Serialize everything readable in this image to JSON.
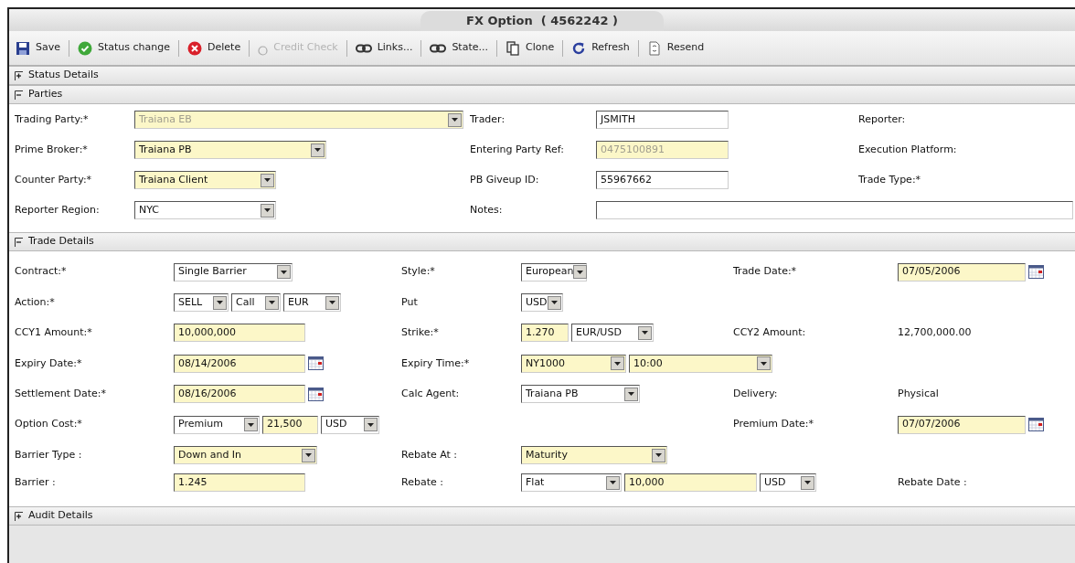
{
  "window": {
    "title": "FX Option  ( 4562242 )"
  },
  "toolbar": [
    {
      "kind": "save",
      "label": "Save",
      "disabled": false
    },
    {
      "kind": "status",
      "label": "Status change",
      "disabled": false
    },
    {
      "kind": "delete",
      "label": "Delete",
      "disabled": false
    },
    {
      "kind": "credit",
      "label": "Credit Check",
      "disabled": true
    },
    {
      "kind": "link",
      "label": "Links...",
      "disabled": false
    },
    {
      "kind": "link",
      "label": "State...",
      "disabled": false
    },
    {
      "kind": "clone",
      "label": "Clone",
      "disabled": false
    },
    {
      "kind": "refresh",
      "label": "Refresh",
      "disabled": false
    },
    {
      "kind": "resend",
      "label": "Resend",
      "disabled": false
    }
  ],
  "sections": [
    {
      "title": "Status Details",
      "expanded": false
    },
    {
      "title": "Parties",
      "expanded": true,
      "rows": [
        {
          "col_1": {
            "label": "Trading Party:*",
            "controls": [
              {
                "kind": "select",
                "value": "Traiana EB",
                "highlighted": true,
                "disabled": true
              }
            ]
          },
          "col_2": {
            "label": "Trader:",
            "controls": [
              {
                "kind": "input",
                "value": "JSMITH",
                "highlighted": false,
                "disabled": false
              }
            ]
          },
          "col_3": {
            "label": "Reporter:"
          }
        },
        {
          "col_1": {
            "label": "Prime Broker:*",
            "controls": [
              {
                "kind": "select",
                "value": "Traiana PB",
                "highlighted": true,
                "disabled": false
              }
            ]
          },
          "col_2": {
            "label": "Entering Party Ref:",
            "controls": [
              {
                "kind": "input",
                "value": "0475100891",
                "highlighted": true,
                "disabled": true
              }
            ]
          },
          "col_3": {
            "label": "Execution Platform:"
          }
        },
        {
          "col_1": {
            "label": "Counter Party:*",
            "controls": [
              {
                "kind": "select",
                "value": "Traiana Client",
                "highlighted": true,
                "disabled": false
              }
            ]
          },
          "col_2": {
            "label": "PB Giveup ID:",
            "controls": [
              {
                "kind": "input",
                "value": "55967662",
                "highlighted": false,
                "disabled": false
              }
            ]
          },
          "col_3": {
            "label": "Trade Type:*"
          }
        },
        {
          "col_1": {
            "label": "Reporter Region:",
            "controls": [
              {
                "kind": "select",
                "value": "NYC",
                "highlighted": false,
                "disabled": false
              }
            ]
          },
          "col_2": {
            "label": "Notes:",
            "controls": [
              {
                "kind": "notes",
                "highlighted": false
              }
            ]
          }
        }
      ]
    },
    {
      "title": "Trade Details",
      "expanded": true,
      "rows": [
        {
          "col_1": {
            "label": "Contract:*",
            "controls": [
              {
                "kind": "select",
                "value": "Single Barrier",
                "highlighted": false,
                "disabled": false
              }
            ]
          },
          "col_2": {
            "label": "Style:*",
            "controls": [
              {
                "kind": "select",
                "value": "European",
                "highlighted": false,
                "disabled": false
              }
            ]
          },
          "col_3": {
            "label": "Trade Date:*",
            "controls": [
              {
                "kind": "date",
                "value": "07/05/2006",
                "highlighted": true,
                "disabled": false
              }
            ]
          }
        },
        {
          "col_1": {
            "label": "Action:*",
            "controls": [
              {
                "kind": "select",
                "value": "SELL",
                "highlighted": false,
                "disabled": false
              },
              {
                "kind": "select",
                "value": "Call",
                "highlighted": false,
                "disabled": false
              },
              {
                "kind": "select",
                "value": "EUR",
                "highlighted": false,
                "disabled": false
              }
            ]
          },
          "col_2": {
            "label": "Put",
            "controls": [
              {
                "kind": "select",
                "value": "USD",
                "highlighted": false,
                "disabled": false
              }
            ]
          }
        },
        {
          "col_1": {
            "label": "CCY1 Amount:*",
            "controls": [
              {
                "kind": "input",
                "value": "10,000,000",
                "highlighted": true,
                "disabled": false
              }
            ]
          },
          "col_2": {
            "label": "Strike:*",
            "controls": [
              {
                "kind": "input",
                "value": "1.270",
                "highlighted": true,
                "disabled": false
              },
              {
                "kind": "select",
                "value": "EUR/USD",
                "highlighted": false,
                "disabled": false
              }
            ]
          },
          "col_3": {
            "label": "CCY2 Amount:",
            "controls": [
              {
                "kind": "text",
                "value": "12,700,000.00"
              }
            ]
          }
        },
        {
          "col_1": {
            "label": "Expiry Date:*",
            "controls": [
              {
                "kind": "date",
                "value": "08/14/2006",
                "highlighted": true,
                "disabled": false
              }
            ]
          },
          "col_2": {
            "label": "Expiry Time:*",
            "controls": [
              {
                "kind": "select",
                "value": "NY1000",
                "highlighted": true,
                "disabled": false
              },
              {
                "kind": "select",
                "value": "10:00",
                "highlighted": true,
                "disabled": false
              }
            ]
          }
        },
        {
          "col_1": {
            "label": "Settlement Date:*",
            "controls": [
              {
                "kind": "date",
                "value": "08/16/2006",
                "highlighted": true,
                "disabled": false
              }
            ]
          },
          "col_2": {
            "label": "Calc Agent:",
            "controls": [
              {
                "kind": "select",
                "value": "Traiana PB",
                "highlighted": false,
                "disabled": false
              }
            ]
          },
          "col_3": {
            "label": "Delivery:",
            "controls": [
              {
                "kind": "text",
                "value": "Physical"
              }
            ]
          }
        },
        {
          "col_1": {
            "label": "Option Cost:*",
            "controls": [
              {
                "kind": "select",
                "value": "Premium",
                "highlighted": false,
                "disabled": false
              },
              {
                "kind": "input",
                "value": "21,500",
                "highlighted": true,
                "disabled": false
              },
              {
                "kind": "select",
                "value": "USD",
                "highlighted": false,
                "disabled": false
              }
            ]
          },
          "col_3": {
            "label": "Premium Date:*",
            "controls": [
              {
                "kind": "date",
                "value": "07/07/2006",
                "highlighted": true,
                "disabled": false
              }
            ]
          }
        },
        {
          "col_1": {
            "label": "Barrier Type :",
            "controls": [
              {
                "kind": "select",
                "value": "Down and In",
                "highlighted": true,
                "disabled": false
              }
            ]
          },
          "col_2": {
            "label": "Rebate At :",
            "controls": [
              {
                "kind": "select",
                "value": "Maturity",
                "highlighted": true,
                "disabled": false
              }
            ]
          }
        },
        {
          "col_1": {
            "label": "Barrier :",
            "controls": [
              {
                "kind": "input",
                "value": "1.245",
                "highlighted": true,
                "disabled": false
              }
            ]
          },
          "col_2": {
            "label": "Rebate :",
            "controls": [
              {
                "kind": "select",
                "value": "Flat",
                "highlighted": false,
                "disabled": false
              },
              {
                "kind": "input",
                "value": "10,000",
                "highlighted": true,
                "disabled": false
              },
              {
                "kind": "select",
                "value": "USD",
                "highlighted": false,
                "disabled": false
              }
            ]
          },
          "col_3": {
            "label": "Rebate Date :"
          }
        }
      ]
    },
    {
      "title": "Audit Details",
      "expanded": false
    }
  ]
}
